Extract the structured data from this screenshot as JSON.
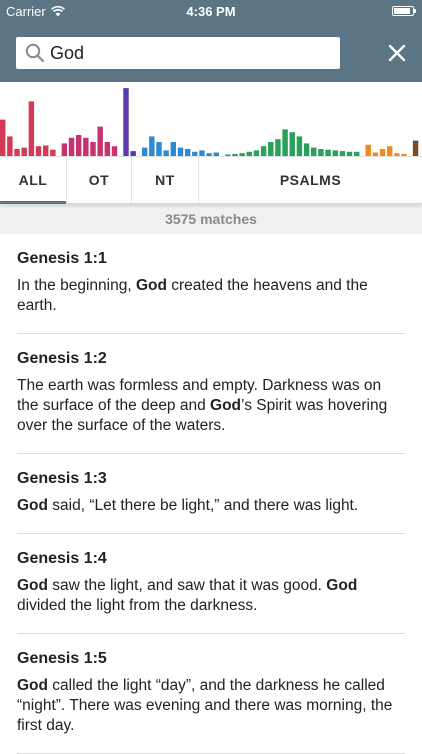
{
  "status_bar": {
    "carrier": "Carrier",
    "time": "4:36 PM",
    "battery_level": 0.9
  },
  "search": {
    "query": "God",
    "placeholder": ""
  },
  "histogram": {
    "groups": [
      {
        "color": "#d23a58",
        "values": [
          0.52,
          0.28,
          0.1,
          0.12,
          0.78,
          0.14,
          0.15,
          0.09
        ]
      },
      {
        "color": "#c8326e",
        "values": [
          0.18,
          0.26,
          0.3,
          0.26,
          0.2,
          0.42,
          0.2,
          0.14
        ]
      },
      {
        "color": "#5b3ab0",
        "values": [
          0.97,
          0.07
        ]
      },
      {
        "color": "#2b8ad0",
        "values": [
          0.12,
          0.28,
          0.2,
          0.08,
          0.2,
          0.12,
          0.1,
          0.06,
          0.08,
          0.04,
          0.05
        ]
      },
      {
        "color": "#2aa05a",
        "values": [
          0.02,
          0.03,
          0.04,
          0.06,
          0.08,
          0.14,
          0.2,
          0.24,
          0.38,
          0.34,
          0.28,
          0.18,
          0.12,
          0.1,
          0.09,
          0.08,
          0.07,
          0.06,
          0.06
        ]
      },
      {
        "color": "#f08a20",
        "values": [
          0.16,
          0.05,
          0.1,
          0.14,
          0.04,
          0.03
        ]
      },
      {
        "color": "#7a4a2a",
        "values": [
          0.22
        ]
      }
    ]
  },
  "tabs": [
    {
      "label": "ALL",
      "active": true
    },
    {
      "label": "OT",
      "active": false
    },
    {
      "label": "NT",
      "active": false
    },
    {
      "label": "PSALMS",
      "active": false
    }
  ],
  "match_count": "3575 matches",
  "results": [
    {
      "reference": "Genesis 1:1",
      "segments": [
        {
          "t": "In the beginning, ",
          "b": false
        },
        {
          "t": "God",
          "b": true
        },
        {
          "t": " created the heavens and the earth.",
          "b": false
        }
      ]
    },
    {
      "reference": "Genesis 1:2",
      "segments": [
        {
          "t": "The earth was formless and empty. Darkness was on the surface of the deep and ",
          "b": false
        },
        {
          "t": "God",
          "b": true
        },
        {
          "t": "’s Spirit was hovering over the surface of the waters.",
          "b": false
        }
      ]
    },
    {
      "reference": "Genesis 1:3",
      "segments": [
        {
          "t": "God",
          "b": true
        },
        {
          "t": " said, “Let there be light,” and there was light.",
          "b": false
        }
      ]
    },
    {
      "reference": "Genesis 1:4",
      "segments": [
        {
          "t": "God",
          "b": true
        },
        {
          "t": " saw the light, and saw that it was good. ",
          "b": false
        },
        {
          "t": "God",
          "b": true
        },
        {
          "t": " divided the light from the darkness.",
          "b": false
        }
      ]
    },
    {
      "reference": "Genesis 1:5",
      "segments": [
        {
          "t": "God",
          "b": true
        },
        {
          "t": " called the light “day”, and the darkness he called “night”. There was evening and there was morning, the first day.",
          "b": false
        }
      ]
    }
  ]
}
